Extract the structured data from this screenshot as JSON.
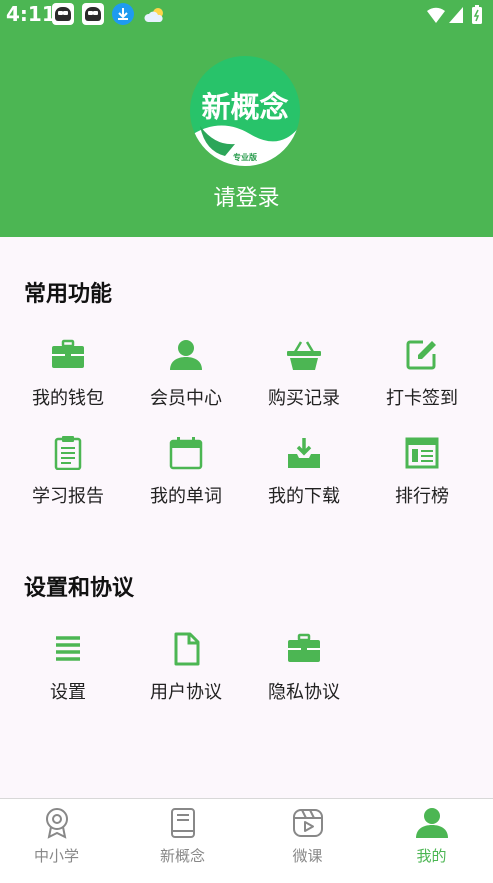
{
  "status_bar": {
    "time": "4:11"
  },
  "profile": {
    "logo_text": "新概念",
    "logo_sub": "专业版",
    "login_text": "请登录"
  },
  "common": {
    "title": "常用功能",
    "items": [
      {
        "label": "我的钱包",
        "icon": "briefcase-icon"
      },
      {
        "label": "会员中心",
        "icon": "person-icon"
      },
      {
        "label": "购买记录",
        "icon": "basket-icon"
      },
      {
        "label": "打卡签到",
        "icon": "edit-icon"
      },
      {
        "label": "学习报告",
        "icon": "clipboard-icon"
      },
      {
        "label": "我的单词",
        "icon": "calendar-icon"
      },
      {
        "label": "我的下载",
        "icon": "download-icon"
      },
      {
        "label": "排行榜",
        "icon": "list-board-icon"
      }
    ]
  },
  "settings": {
    "title": "设置和协议",
    "items": [
      {
        "label": "设置",
        "icon": "menu-icon"
      },
      {
        "label": "用户协议",
        "icon": "document-icon"
      },
      {
        "label": "隐私协议",
        "icon": "briefcase-icon"
      }
    ]
  },
  "tabs": [
    {
      "label": "中小学",
      "icon": "medal-icon"
    },
    {
      "label": "新概念",
      "icon": "book-icon"
    },
    {
      "label": "微课",
      "icon": "video-icon"
    },
    {
      "label": "我的",
      "icon": "person-icon",
      "active": true
    }
  ],
  "colors": {
    "brand": "#4cb653",
    "background": "#fcf7fc"
  }
}
